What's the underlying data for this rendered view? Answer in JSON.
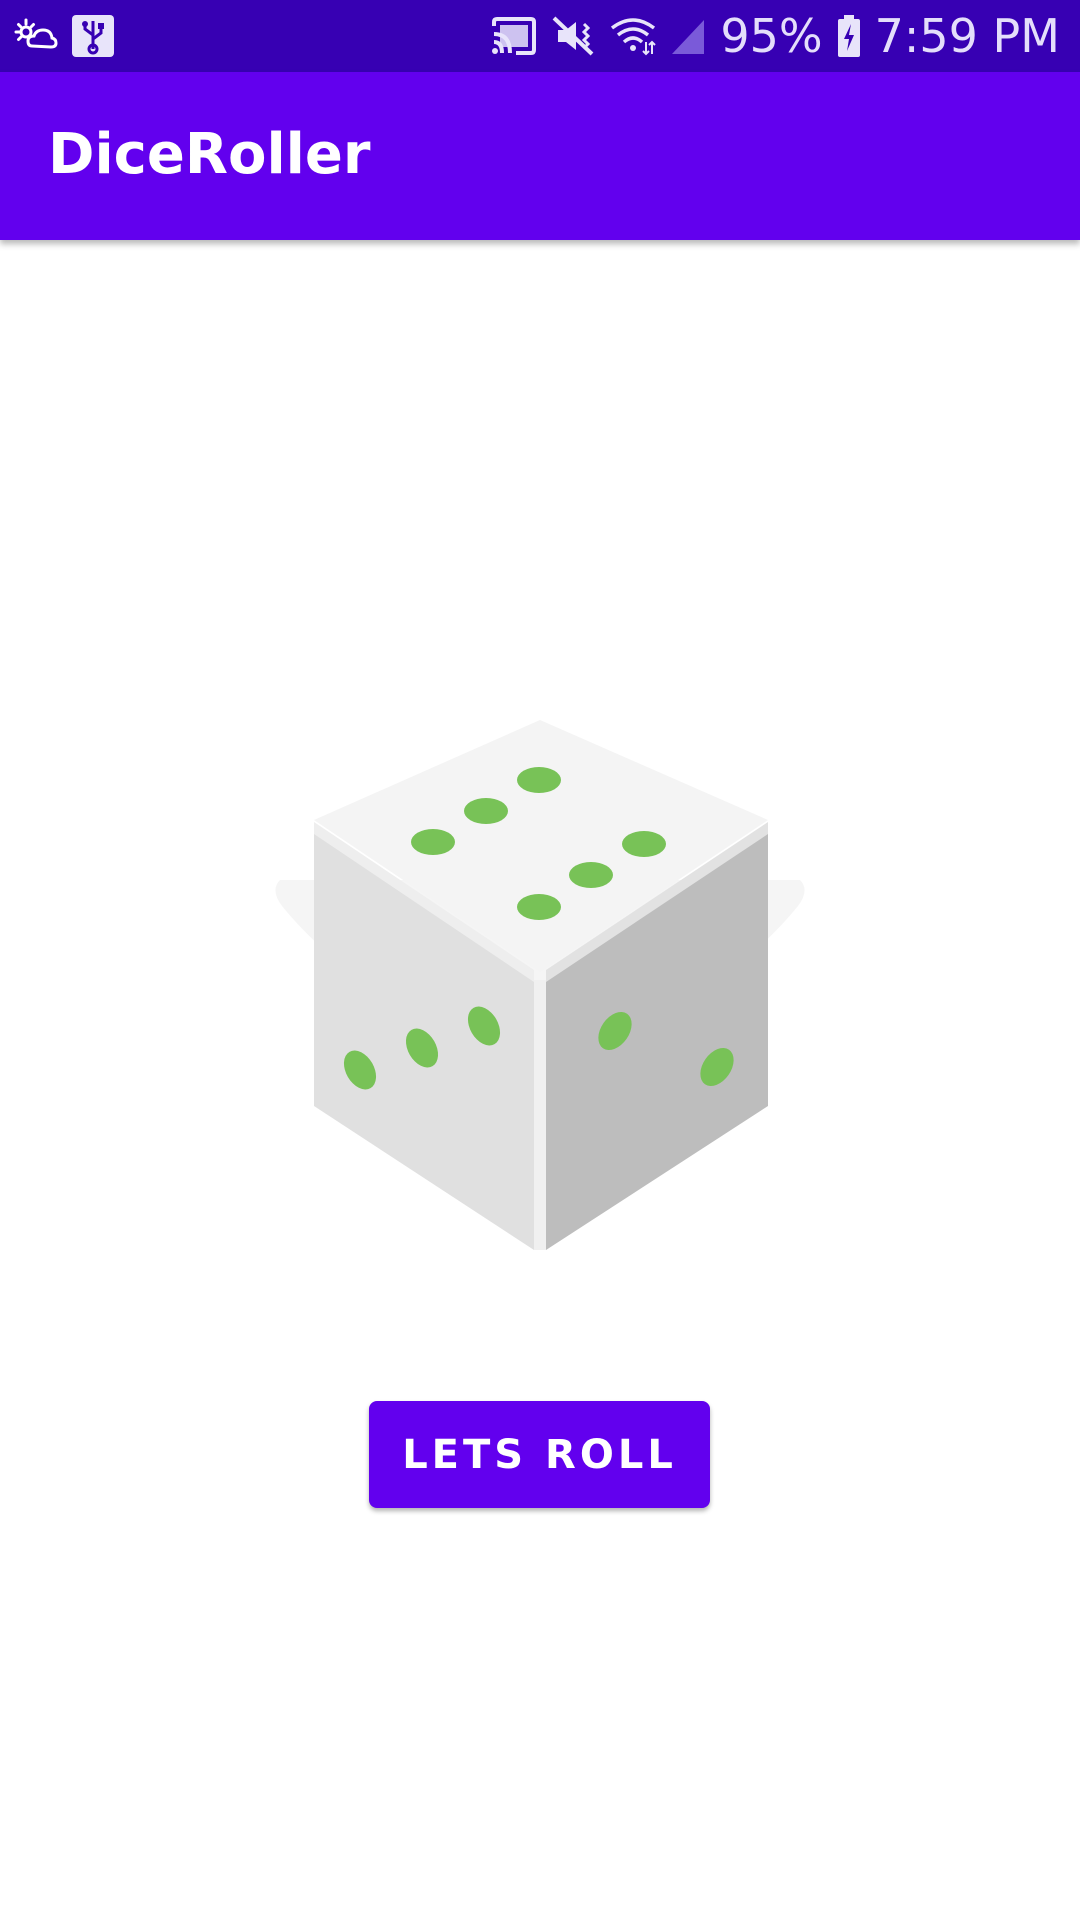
{
  "status_bar": {
    "icons_left": [
      "weather-cloud-icon",
      "usb-icon"
    ],
    "icons_right": [
      "cast-icon",
      "vibrate-mute-icon",
      "wifi-icon",
      "cell-signal-icon",
      "battery-charging-icon"
    ],
    "battery": "95%",
    "time": "7:59 PM",
    "bg_color": "#3700B3"
  },
  "app_bar": {
    "title": "DiceRoller",
    "bg_color": "#6200EE"
  },
  "dice": {
    "top_face_value": 6,
    "left_face_value": 3,
    "right_face_value": 2,
    "pip_color": "#78C257"
  },
  "roll_button": {
    "label": "LETS ROLL",
    "bg_color": "#6200EE"
  }
}
